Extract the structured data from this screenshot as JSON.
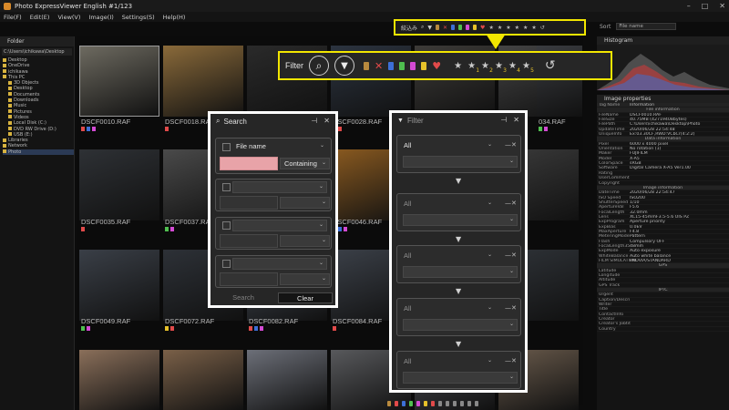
{
  "window": {
    "title": "Photo ExpressViewer English  #1/123"
  },
  "menu": [
    "File(F)",
    "Edit(E)",
    "View(V)",
    "Image(I)",
    "Settings(S)",
    "Help(H)"
  ],
  "mini_toolbar": {
    "label": "絞込み"
  },
  "sort": {
    "label": "Sort",
    "value": "File name"
  },
  "folder_panel": {
    "title": "Folder",
    "path": "C:\\Users\\ichikawa\\Desktop",
    "items": [
      "Desktop",
      "OneDrive",
      "ichikawa",
      "This PC",
      "3D Objects",
      "Desktop",
      "Documents",
      "Downloads",
      "Music",
      "Pictures",
      "Videos",
      "Local Disk (C:)",
      "DVD RW Drive (D:)",
      "USB (E:)",
      "Libraries",
      "Network",
      "Photo"
    ]
  },
  "histogram": {
    "title": "Histogram"
  },
  "properties": {
    "title": "Image properties",
    "col_tag": "Tag Name",
    "col_info": "Information",
    "rows": [
      {
        "section": "File information"
      },
      {
        "k": "FileName",
        "v": "DSCF0010.RAF"
      },
      {
        "k": "FileSize",
        "v": "40.75MB (42719408bytes)"
      },
      {
        "k": "FilePath",
        "v": "C:\\Users\\ichikawa\\Desktop\\Photo"
      },
      {
        "k": "UpdateTime",
        "v": "2020/06/28 22:54:48"
      },
      {
        "k": "UniqueInfo",
        "v": "Ex:03.30CF,RWD:VCbCr(4:2:2)"
      },
      {
        "section": "Data information"
      },
      {
        "k": "Pixel",
        "v": "6000 x 4000 pixel"
      },
      {
        "k": "Orientation",
        "v": "No rotation (1)"
      },
      {
        "k": "Maker",
        "v": "FUJIFILM"
      },
      {
        "k": "Model",
        "v": "X-A5"
      },
      {
        "k": "ColorSpace",
        "v": "sRGB"
      },
      {
        "k": "Software",
        "v": "Digital Camera X-A5 Ver1.00"
      },
      {
        "k": "Rating",
        "v": ""
      },
      {
        "k": "UserComment",
        "v": ""
      },
      {
        "k": "Copyright",
        "v": ""
      },
      {
        "section": "Image information"
      },
      {
        "k": "DateTime",
        "v": "2020/06/28 22:54:47"
      },
      {
        "k": "ISO Speed",
        "v": "ISO200"
      },
      {
        "k": "ShutterSpeed",
        "v": "1/10"
      },
      {
        "k": "ApertureVal",
        "v": "F5.6"
      },
      {
        "k": "FocalLength",
        "v": "32.0mm"
      },
      {
        "k": "Lens",
        "v": "XC15-45mmF3.5-5.6 OIS PZ"
      },
      {
        "k": "ExpProgram",
        "v": "Aperture priority"
      },
      {
        "k": "ExpBias",
        "v": "0.0EV"
      },
      {
        "k": "MaxAperture",
        "v": "F4.8"
      },
      {
        "k": "MeteringMode",
        "v": "Pattern"
      },
      {
        "k": "Flash",
        "v": "Compulsory OFF"
      },
      {
        "k": "FocalLength35",
        "v": "48mm"
      },
      {
        "k": "ExpMode",
        "v": "Auto exposure"
      },
      {
        "k": "WhiteBalance",
        "v": "Auto white balance"
      },
      {
        "k": "FILM SIMULATION",
        "v": "PROVIA/STANDARD"
      },
      {
        "section": "GPS"
      },
      {
        "k": "Latitude",
        "v": ""
      },
      {
        "k": "Longitude",
        "v": ""
      },
      {
        "k": "Altitude",
        "v": ""
      },
      {
        "k": "GPS Track",
        "v": ""
      },
      {
        "section": "IPTC"
      },
      {
        "k": "Urgent",
        "v": ""
      },
      {
        "k": "Caption/Descri",
        "v": ""
      },
      {
        "k": "Writer",
        "v": ""
      },
      {
        "k": "Title",
        "v": ""
      },
      {
        "k": "ContactInfo",
        "v": ""
      },
      {
        "k": "Creator",
        "v": ""
      },
      {
        "k": "Creator's Jobtit",
        "v": ""
      },
      {
        "k": "Country",
        "v": ""
      }
    ]
  },
  "filter_toolbar": {
    "label": "Filter",
    "star_levels": [
      "1",
      "2",
      "3",
      "4",
      "5"
    ]
  },
  "thumbnails": {
    "row1": [
      "DSCF0010.RAF",
      "DSCF0018.RAF",
      "",
      "DSCF0028.RAF",
      "",
      "",
      "034.RAF"
    ],
    "row2": [
      "DSCF0035.RAF",
      "DSCF0037.RAF",
      "DSCF0039.RAF",
      "DSCF0046.RAF",
      "",
      "",
      ""
    ],
    "row3": [
      "DSCF0049.RAF",
      "DSCF0072.RAF",
      "DSCF0082.RAF",
      "DSCF0084.RAF",
      "",
      "",
      ""
    ]
  },
  "search_dialog": {
    "title": "Search",
    "criteria_label": "File name",
    "match_mode": "Containing",
    "search_button": "Search",
    "clear_button": "Clear"
  },
  "filter_dialog": {
    "title": "Filter",
    "first_value": "All",
    "other_value": "All"
  },
  "colors": {
    "highlight": "#f2e600",
    "dialog_border": "#ffffff",
    "search_field": "#e8a3a8"
  }
}
